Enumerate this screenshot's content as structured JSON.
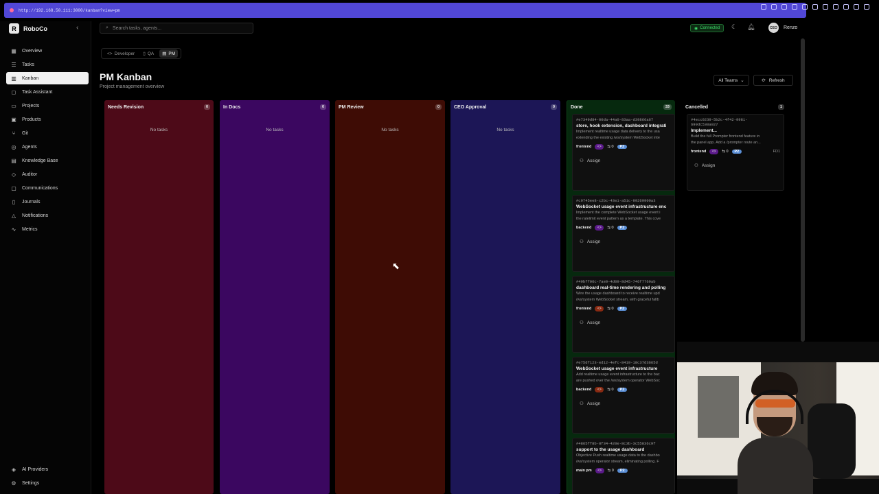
{
  "browser": {
    "url": "http://192.168.50.111:3000/kanban?view=pm"
  },
  "app": {
    "name": "RoboCo",
    "logo_letter": "R"
  },
  "sidebar": {
    "items": [
      {
        "label": "Overview",
        "icon": "grid-icon",
        "glyph": "▦"
      },
      {
        "label": "Tasks",
        "icon": "list-icon",
        "glyph": "☰"
      },
      {
        "label": "Kanban",
        "icon": "kanban-icon",
        "glyph": "▥",
        "active": true
      },
      {
        "label": "Task Assistant",
        "icon": "chat-icon",
        "glyph": "◻"
      },
      {
        "label": "Projects",
        "icon": "folder-icon",
        "glyph": "▭"
      },
      {
        "label": "Products",
        "icon": "box-icon",
        "glyph": "▣"
      },
      {
        "label": "Git",
        "icon": "git-branch-icon",
        "glyph": "⑂"
      },
      {
        "label": "Agents",
        "icon": "bot-icon",
        "glyph": "◎"
      },
      {
        "label": "Knowledge Base",
        "icon": "book-icon",
        "glyph": "▤"
      },
      {
        "label": "Auditor",
        "icon": "shield-icon",
        "glyph": "◇"
      },
      {
        "label": "Communications",
        "icon": "message-icon",
        "glyph": "▢"
      },
      {
        "label": "Journals",
        "icon": "journal-icon",
        "glyph": "▯"
      },
      {
        "label": "Notifications",
        "icon": "bell-icon",
        "glyph": "△"
      },
      {
        "label": "Metrics",
        "icon": "activity-icon",
        "glyph": "∿"
      }
    ],
    "bottom_items": [
      {
        "label": "AI Providers",
        "icon": "cpu-icon",
        "glyph": "◈"
      },
      {
        "label": "Settings",
        "icon": "gear-icon",
        "glyph": "⚙"
      }
    ]
  },
  "topbar": {
    "search_placeholder": "Search tasks, agents...",
    "status": "Connected",
    "user_initials": "CEO",
    "user_name": "Renzo"
  },
  "role_tabs": [
    {
      "label": "Developer",
      "glyph": "<>",
      "active": false
    },
    {
      "label": "QA",
      "glyph": "▯",
      "active": false
    },
    {
      "label": "PM",
      "glyph": "▤",
      "active": true
    }
  ],
  "page": {
    "title": "PM Kanban",
    "subtitle": "Project management overview",
    "team_filter": "All Teams",
    "refresh_label": "Refresh"
  },
  "columns": [
    {
      "name": "Needs Revision",
      "count": "0",
      "color": "#4d0a18",
      "empty_text": "No tasks"
    },
    {
      "name": "In Docs",
      "count": "0",
      "color": "#3b0760",
      "empty_text": "No tasks"
    },
    {
      "name": "PM Review",
      "count": "0",
      "color": "#3e0c05",
      "empty_text": "No tasks"
    },
    {
      "name": "CEO Approval",
      "count": "0",
      "color": "#1c1656",
      "empty_text": "No tasks"
    },
    {
      "name": "Done",
      "count": "33",
      "color": "#06290e",
      "empty_text": ""
    },
    {
      "name": "Cancelled",
      "count": "1",
      "color": "#000000",
      "empty_text": ""
    }
  ],
  "done_cards": [
    {
      "id": "#e7349d84-00da-44a0-83aa-d39866a67",
      "title": "store, hook extension, dashboard integrati",
      "desc": [
        "Implement realtime usage data delivery to the usa",
        "extending the existing /ws/system WebSocket inte"
      ],
      "tag": "frontend",
      "type_color": "#5b1a8a",
      "comments": "0",
      "priority": "P2",
      "assign": "Assign"
    },
    {
      "id": "#c9745ee8-c2bc-43e1-a51c-99269900a3",
      "title": "WebSocket usage event infrastructure enc",
      "desc": [
        "Implement the complete WebSocket usage event i",
        "the ratelimit event pattern as a template. This cove"
      ],
      "tag": "backend",
      "type_color": "#5b1a8a",
      "comments": "0",
      "priority": "P2",
      "assign": "Assign"
    },
    {
      "id": "#49bff06c-7ae0-4d09-8d45-746f7769ab",
      "title": "dashboard real-time rendering and polling",
      "desc": [
        "Wire the usage dashboard to receive realtime upd",
        "/ws/system WebSocket stream, with graceful fallb"
      ],
      "tag": "frontend",
      "type_color": "#8a2a12",
      "comments": "0",
      "priority": "P2",
      "assign": "Assign"
    },
    {
      "id": "#e75df123-ed12-4efc-8419-18c37d3665d",
      "title": "WebSocket usage event infrastructure",
      "desc": [
        "Add realtime usage event infrastructure to the bac",
        "are pushed over the /ws/system operator WebSoc"
      ],
      "tag": "backend",
      "type_color": "#8a2a12",
      "comments": "0",
      "priority": "P2",
      "assign": "Assign"
    },
    {
      "id": "#4865ff8b-8f34-420e-8c3b-3c55836c9f",
      "title": "support to the usage dashboard",
      "desc": [
        "Objective Push realtime usage data to the dashbo",
        "/ws/system operator stream, eliminating polling. F"
      ],
      "tag": "main pm",
      "type_color": "#5b1a8a",
      "comments": "0",
      "priority": "P2",
      "assign": ""
    }
  ],
  "cancelled_cards": [
    {
      "id": "#4ecc0239-5b2c-4f42-9981-",
      "id2": "699dc530a027",
      "title": "Implement...",
      "desc": [
        "Build the full Prompter frontend feature in",
        "the panel app. Add a /prompter route an..."
      ],
      "tag": "frontend",
      "type_color": "#5b1a8a",
      "comments": "0",
      "priority": "P2",
      "extra": "FD1",
      "assign": "Assign"
    }
  ]
}
